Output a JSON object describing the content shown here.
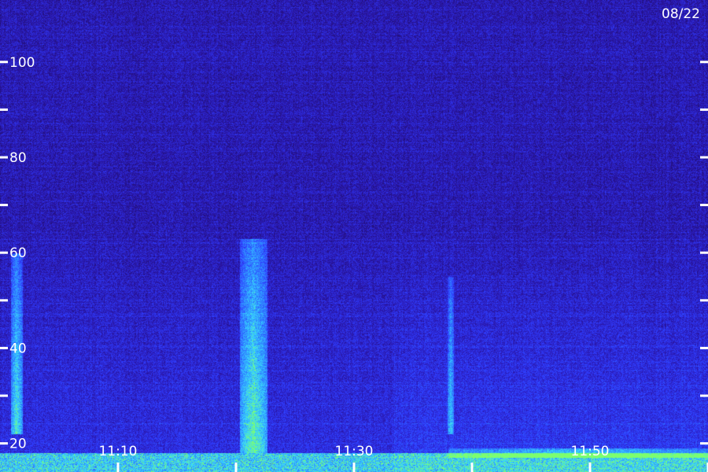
{
  "chart_data": {
    "type": "heatmap",
    "title": "",
    "xlabel": "",
    "ylabel": "",
    "date_label": "08/22",
    "y_range": [
      14,
      113
    ],
    "y_ticks": [
      20,
      30,
      40,
      50,
      60,
      70,
      80,
      90,
      100
    ],
    "y_tick_labels": [
      {
        "value": 20,
        "label": "20"
      },
      {
        "value": 40,
        "label": "40"
      },
      {
        "value": 60,
        "label": "60"
      },
      {
        "value": 80,
        "label": "80"
      },
      {
        "value": 100,
        "label": "100"
      }
    ],
    "x_range_minutes": [
      0,
      60
    ],
    "x_ticks_minutes": [
      10,
      20,
      30,
      40,
      50,
      60
    ],
    "x_tick_labels": [
      {
        "minute": 10,
        "label": "11:10"
      },
      {
        "minute": 30,
        "label": "11:30"
      },
      {
        "minute": 50,
        "label": "11:50"
      }
    ],
    "colormap": [
      "#1a0a4a",
      "#2a16a8",
      "#2f3cff",
      "#2f8cff",
      "#38d6ff",
      "#7dff6e"
    ],
    "grid": false,
    "features": [
      {
        "name": "burst",
        "x_minutes": [
          0.9,
          1.9
        ],
        "y": [
          22,
          60
        ],
        "intensity": 0.62
      },
      {
        "name": "burst",
        "x_minutes": [
          20.3,
          22.6
        ],
        "y": [
          18,
          63
        ],
        "intensity": 0.72
      },
      {
        "name": "burst",
        "x_minutes": [
          37.9,
          38.4
        ],
        "y": [
          22,
          55
        ],
        "intensity": 0.45
      },
      {
        "name": "band",
        "x_minutes": [
          38,
          60
        ],
        "y": [
          17,
          19
        ],
        "intensity": 0.6
      }
    ]
  }
}
